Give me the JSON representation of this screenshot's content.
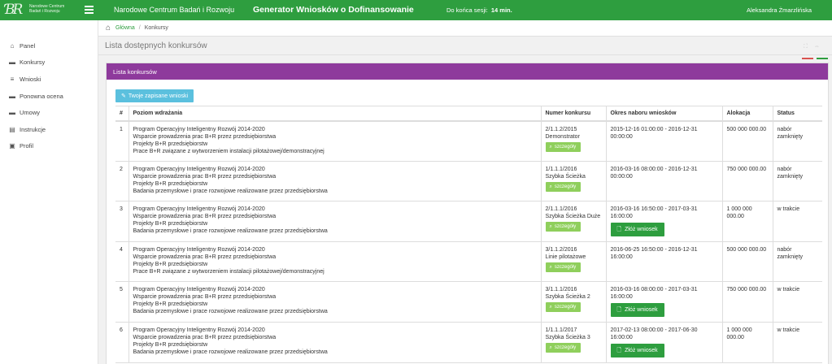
{
  "header": {
    "logo_lines": [
      "Narodowe Centrum",
      "Badań i Rozwoju"
    ],
    "org_name": "Narodowe Centrum Badań i Rozwoju",
    "app_title": "Generator Wniosków o Dofinansowanie",
    "session_label": "Do końca sesji:",
    "session_time": "14 min.",
    "user_name": "Aleksandra Żmarzlińska"
  },
  "sidebar": {
    "items": [
      {
        "label": "Panel",
        "icon": "home-icon"
      },
      {
        "label": "Konkursy",
        "icon": "folder-icon"
      },
      {
        "label": "Wnioski",
        "icon": "list-icon"
      },
      {
        "label": "Ponowna ocena",
        "icon": "folder-icon"
      },
      {
        "label": "Umowy",
        "icon": "folder-icon"
      },
      {
        "label": "Instrukcje",
        "icon": "book-icon"
      },
      {
        "label": "Profil",
        "icon": "image-icon"
      }
    ]
  },
  "breadcrumb": {
    "home": "Główna",
    "current": "Konkursy"
  },
  "page": {
    "heading": "Lista dostępnych konkursów"
  },
  "panel": {
    "title": "Lista konkursów",
    "saved_button": "Twoje zapisane wnioski"
  },
  "table": {
    "headers": [
      "#",
      "Poziom wdrażania",
      "Numer konkursu",
      "Okres naboru wniosków",
      "Alokacja",
      "Status"
    ],
    "details_label": "szczegóły",
    "submit_label": "Złóż wniosek",
    "rows": [
      {
        "num": "1",
        "level": [
          "Program Operacyjny Inteligentny Rozwój 2014-2020",
          "Wsparcie prowadzenia prac B+R przez przedsiębiorstwa",
          "Projekty B+R przedsiębiorstw",
          "Prace B+R związane z wytworzeniem instalacji pilotażowej/demonstracyjnej"
        ],
        "number": "2/1.1.2/2015",
        "name": "Demonstrator",
        "period": [
          "2015-12-16 01:00:00 - 2016-12-31",
          "00:00:00"
        ],
        "allocation": "500 000 000.00",
        "status": [
          "nabór",
          "zamknięty"
        ],
        "can_submit": false
      },
      {
        "num": "2",
        "level": [
          "Program Operacyjny Inteligentny Rozwój 2014-2020",
          "Wsparcie prowadzenia prac B+R przez przedsiębiorstwa",
          "Projekty B+R przedsiębiorstw",
          "Badania przemysłowe i prace rozwojowe realizowane przez przedsiębiorstwa"
        ],
        "number": "1/1.1.1/2016",
        "name": "Szybka Ścieżka",
        "period": [
          "2016-03-16 08:00:00 - 2016-12-31",
          "00:00:00"
        ],
        "allocation": "750 000 000.00",
        "status": [
          "nabór",
          "zamknięty"
        ],
        "can_submit": false
      },
      {
        "num": "3",
        "level": [
          "Program Operacyjny Inteligentny Rozwój 2014-2020",
          "Wsparcie prowadzenia prac B+R przez przedsiębiorstwa",
          "Projekty B+R przedsiębiorstw",
          "Badania przemysłowe i prace rozwojowe realizowane przez przedsiębiorstwa"
        ],
        "number": "2/1.1.1/2016",
        "name": "Szybka Ścieżka Duże",
        "period": [
          "2016-03-16 16:50:00 - 2017-03-31",
          "16:00:00"
        ],
        "allocation": "1 000 000 000.00",
        "status": [
          "w trakcie",
          ""
        ],
        "can_submit": true
      },
      {
        "num": "4",
        "level": [
          "Program Operacyjny Inteligentny Rozwój 2014-2020",
          "Wsparcie prowadzenia prac B+R przez przedsiębiorstwa",
          "Projekty B+R przedsiębiorstw",
          "Prace B+R związane z wytworzeniem instalacji pilotażowej/demonstracyjnej"
        ],
        "number": "3/1.1.2/2016",
        "name": "Linie pilotażowe",
        "period": [
          "2016-06-25 16:50:00 - 2016-12-31",
          "16:00:00"
        ],
        "allocation": "500 000 000.00",
        "status": [
          "nabór",
          "zamknięty"
        ],
        "can_submit": false
      },
      {
        "num": "5",
        "level": [
          "Program Operacyjny Inteligentny Rozwój 2014-2020",
          "Wsparcie prowadzenia prac B+R przez przedsiębiorstwa",
          "Projekty B+R przedsiębiorstw",
          "Badania przemysłowe i prace rozwojowe realizowane przez przedsiębiorstwa"
        ],
        "number": "3/1.1.1/2016",
        "name": "Szybka Ścieżka 2",
        "period": [
          "2016-03-16 08:00:00 - 2017-03-31",
          "16:00:00"
        ],
        "allocation": "750 000 000.00",
        "status": [
          "w trakcie",
          ""
        ],
        "can_submit": true
      },
      {
        "num": "6",
        "level": [
          "Program Operacyjny Inteligentny Rozwój 2014-2020",
          "Wsparcie prowadzenia prac B+R przez przedsiębiorstwa",
          "Projekty B+R przedsiębiorstw",
          "Badania przemysłowe i prace rozwojowe realizowane przez przedsiębiorstwa"
        ],
        "number": "1/1.1.1/2017",
        "name": "Szybka Ścieżka 3",
        "period": [
          "2017-02-13 08:00:00 - 2017-06-30",
          "16:00:00"
        ],
        "allocation": "1 000 000 000.00",
        "status": [
          "w trakcie",
          ""
        ],
        "can_submit": true
      }
    ]
  },
  "colors": {
    "topbar": "#2e9e3f",
    "panel_header": "#8e3a9c",
    "info_button": "#5bc0de",
    "details_button": "#8fcf5c",
    "submit_button": "#2e9e3f"
  }
}
